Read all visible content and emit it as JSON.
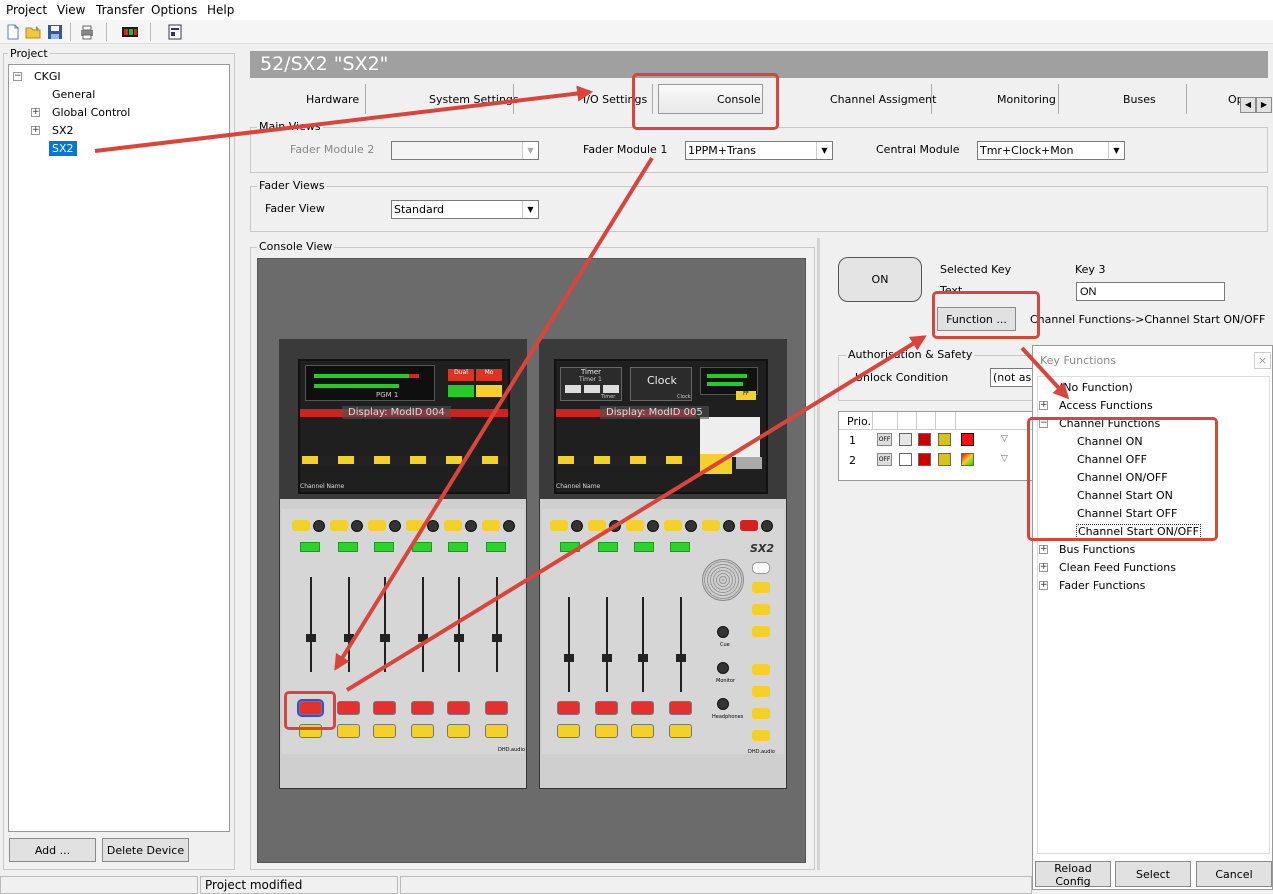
{
  "menu": {
    "project": "Project",
    "view": "View",
    "transfer": "Transfer",
    "options": "Options",
    "help": "Help"
  },
  "toolbar_icons": [
    "new-file-icon",
    "open-folder-icon",
    "save-icon",
    "print-icon",
    "transfer-icon",
    "settings-icon"
  ],
  "project_panel": {
    "label": "Project",
    "tree": {
      "root": "CKGI",
      "general": "General",
      "global_control": "Global Control",
      "sx2": "SX2",
      "sx2_child": "SX2"
    },
    "add_button": "Add ...",
    "delete_button": "Delete Device"
  },
  "device_title": "52/SX2 \"SX2\"",
  "tabs": [
    "Hardware",
    "System Settings",
    "I/O Settings",
    "Console",
    "Channel Assigment",
    "Monitoring",
    "Buses",
    "Op"
  ],
  "main_views": {
    "label": "Main Views",
    "fader_module_2": "Fader Module 2",
    "fader_module_1": "Fader Module 1",
    "fader_module_1_value": "1PPM+Trans",
    "central_module": "Central Module",
    "central_module_value": "Tmr+Clock+Mon"
  },
  "fader_views": {
    "label": "Fader Views",
    "fader_view": "Fader View",
    "fader_view_value": "Standard"
  },
  "console_view": {
    "label": "Console View",
    "display1": "Display: ModID 004",
    "display2": "Display: ModID 005",
    "clock": "Clock",
    "timer": "Timer",
    "brand": "SX2",
    "screen_labels": {
      "pgm": "PGM 1",
      "dual": "Dual",
      "mo": "Mo",
      "timer1": "Timer 1",
      "timer_sub": "Timer",
      "clock_sub": "Clock",
      "ff": "FF"
    },
    "strip_label": "Channel Name",
    "knob_labels": {
      "cue": "Cue",
      "monitor": "Monitor",
      "headphones": "Headphones"
    },
    "maker": "DHD.audio"
  },
  "key_panel": {
    "key_button": "ON",
    "selected_key_label": "Selected Key",
    "key_value": "Key 3",
    "text_label": "Text",
    "text_value": "ON",
    "function_button": "Function ...",
    "function_path": "Channel Functions->Channel Start ON/OFF",
    "auth_label": "Authorisation & Safety",
    "unlock_label": "Unlock Condition",
    "unlock_value": "(not ass",
    "prio_header": "Prio.",
    "prio_rows": [
      {
        "prio": "1",
        "state": "OFF"
      },
      {
        "prio": "2",
        "state": "OFF"
      }
    ]
  },
  "key_functions": {
    "title": "Key Functions",
    "close": "×",
    "items": {
      "no_function": "(No Function)",
      "access": "Access Functions",
      "channel": "Channel Functions",
      "channel_on": "Channel ON",
      "channel_off": "Channel OFF",
      "channel_onoff": "Channel ON/OFF",
      "channel_start_on": "Channel Start ON",
      "channel_start_off": "Channel Start OFF",
      "channel_start_onoff": "Channel Start ON/OFF",
      "bus": "Bus Functions",
      "clean_feed": "Clean Feed Functions",
      "fader": "Fader Functions"
    },
    "reload_button": "Reload Config",
    "select_button": "Select",
    "cancel_button": "Cancel"
  },
  "status": {
    "text": "Project modified"
  },
  "colors": {
    "annotation": "#d9453b",
    "title_bar": "#a0a0a0",
    "selected": "#0078d7",
    "led_green": "#2dd32d",
    "key_red": "#e02020",
    "key_yellow": "#f3d02a"
  }
}
